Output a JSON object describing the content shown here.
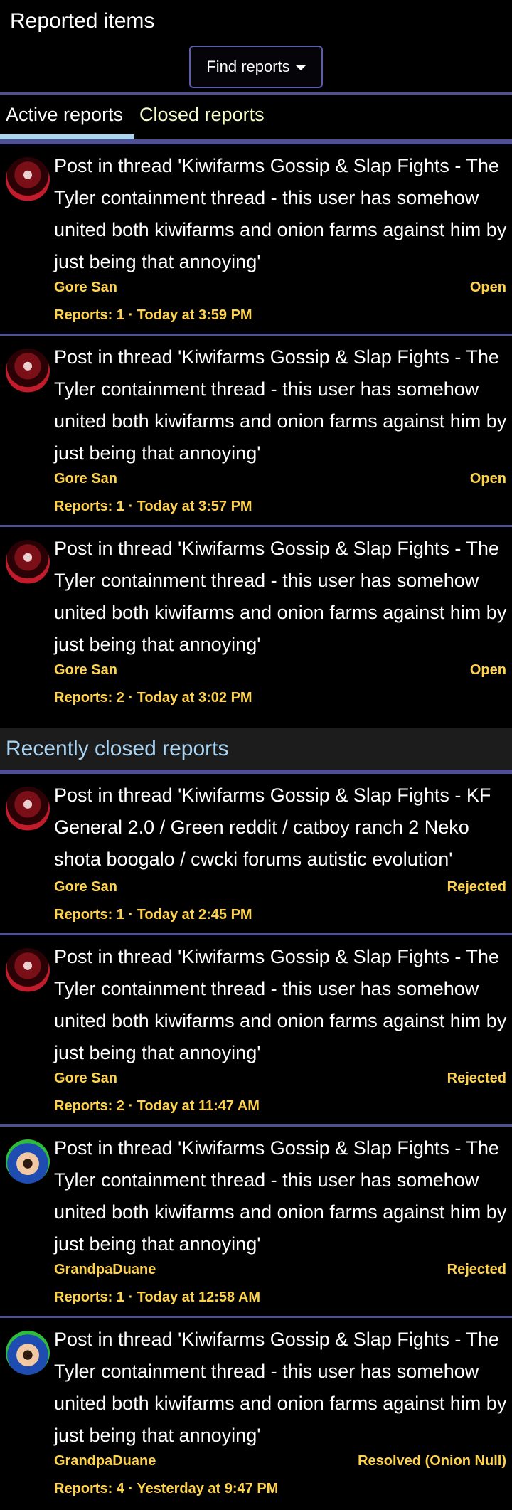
{
  "page": {
    "title": "Reported items"
  },
  "toolbar": {
    "find_reports_label": "Find reports"
  },
  "tabs": [
    {
      "label": "Active reports",
      "active": true
    },
    {
      "label": "Closed reports",
      "active": false
    }
  ],
  "colors": {
    "accent_line": "#4e4f95",
    "meta_text": "#ffd24d",
    "active_tab_indicator": "#aad5f1",
    "section_title": "#a9d4f3",
    "inactive_tab": "#f7ffc8"
  },
  "active_reports": [
    {
      "title": "Post in thread 'Kiwifarms Gossip & Slap Fights - The Tyler containment thread - this user has somehow united both kiwifarms and onion farms against him by just being that annoying'",
      "author": "Gore San",
      "status": "Open",
      "reports": "Reports: 1 · Today at 3:59 PM",
      "avatar": "gore-san-avatar"
    },
    {
      "title": "Post in thread 'Kiwifarms Gossip & Slap Fights - The Tyler containment thread - this user has somehow united both kiwifarms and onion farms against him by just being that annoying'",
      "author": "Gore San",
      "status": "Open",
      "reports": "Reports: 1 · Today at 3:57 PM",
      "avatar": "gore-san-avatar"
    },
    {
      "title": "Post in thread 'Kiwifarms Gossip & Slap Fights - The Tyler containment thread - this user has somehow united both kiwifarms and onion farms against him by just being that annoying'",
      "author": "Gore San",
      "status": "Open",
      "reports": "Reports: 2 · Today at 3:02 PM",
      "avatar": "gore-san-avatar"
    }
  ],
  "recently_closed": {
    "heading": "Recently closed reports",
    "items": [
      {
        "title": "Post in thread 'Kiwifarms Gossip & Slap Fights - KF General 2.0 / Green reddit / catboy ranch 2 Neko shota boogalo / cwcki forums autistic evolution'",
        "author": "Gore San",
        "status": "Rejected",
        "reports": "Reports: 1 · Today at 2:45 PM",
        "avatar": "gore-san-avatar"
      },
      {
        "title": "Post in thread 'Kiwifarms Gossip & Slap Fights - The Tyler containment thread - this user has somehow united both kiwifarms and onion farms against him by just being that annoying'",
        "author": "Gore San",
        "status": "Rejected",
        "reports": "Reports: 2 · Today at 11:47 AM",
        "avatar": "gore-san-avatar"
      },
      {
        "title": "Post in thread 'Kiwifarms Gossip & Slap Fights - The Tyler containment thread - this user has somehow united both kiwifarms and onion farms against him by just being that annoying'",
        "author": "GrandpaDuane",
        "status": "Rejected",
        "reports": "Reports: 1 · Today at 12:58 AM",
        "avatar": "grandpaduane-avatar"
      },
      {
        "title": "Post in thread 'Kiwifarms Gossip & Slap Fights - The Tyler containment thread - this user has somehow united both kiwifarms and onion farms against him by just being that annoying'",
        "author": "GrandpaDuane",
        "status": "Resolved (Onion Null)",
        "reports": "Reports: 4 · Yesterday at 9:47 PM",
        "avatar": "grandpaduane-avatar"
      }
    ]
  }
}
